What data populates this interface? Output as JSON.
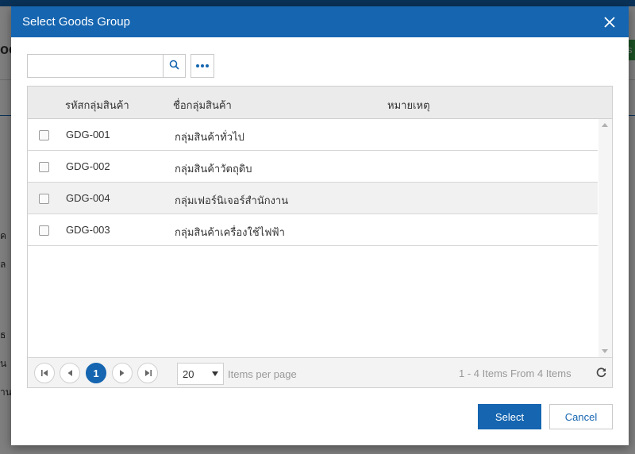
{
  "background": {
    "title_fragment": "oo",
    "green_btn_fragment": "s",
    "side_labels": [
      "ค",
      "ล",
      "ธ",
      "น",
      "าน"
    ]
  },
  "modal": {
    "title": "Select Goods Group",
    "search": {
      "value": "",
      "placeholder": ""
    },
    "columns": {
      "code": "รหัสกลุ่มสินค้า",
      "name": "ชื่อกลุ่มสินค้า",
      "remark": "หมายเหตุ"
    },
    "rows": [
      {
        "code": "GDG-001",
        "name": "กลุ่มสินค้าทั่วไป",
        "remark": "",
        "checked": false
      },
      {
        "code": "GDG-002",
        "name": "กลุ่มสินค้าวัตถุดิบ",
        "remark": "",
        "checked": false
      },
      {
        "code": "GDG-004",
        "name": "กลุ่มเฟอร์นิเจอร์สำนักงาน",
        "remark": "",
        "checked": false
      },
      {
        "code": "GDG-003",
        "name": "กลุ่มสินค้าเครื่องใช้ไฟฟ้า",
        "remark": "",
        "checked": false
      }
    ],
    "pager": {
      "current_page": "1",
      "page_size": "20",
      "items_per_page_label": "Items per page",
      "summary": "1 - 4 Items From 4 Items"
    },
    "buttons": {
      "select": "Select",
      "cancel": "Cancel"
    }
  },
  "colors": {
    "primary": "#1565b0",
    "header_bg": "#ebebeb",
    "alt_row": "#f1f1f1"
  }
}
